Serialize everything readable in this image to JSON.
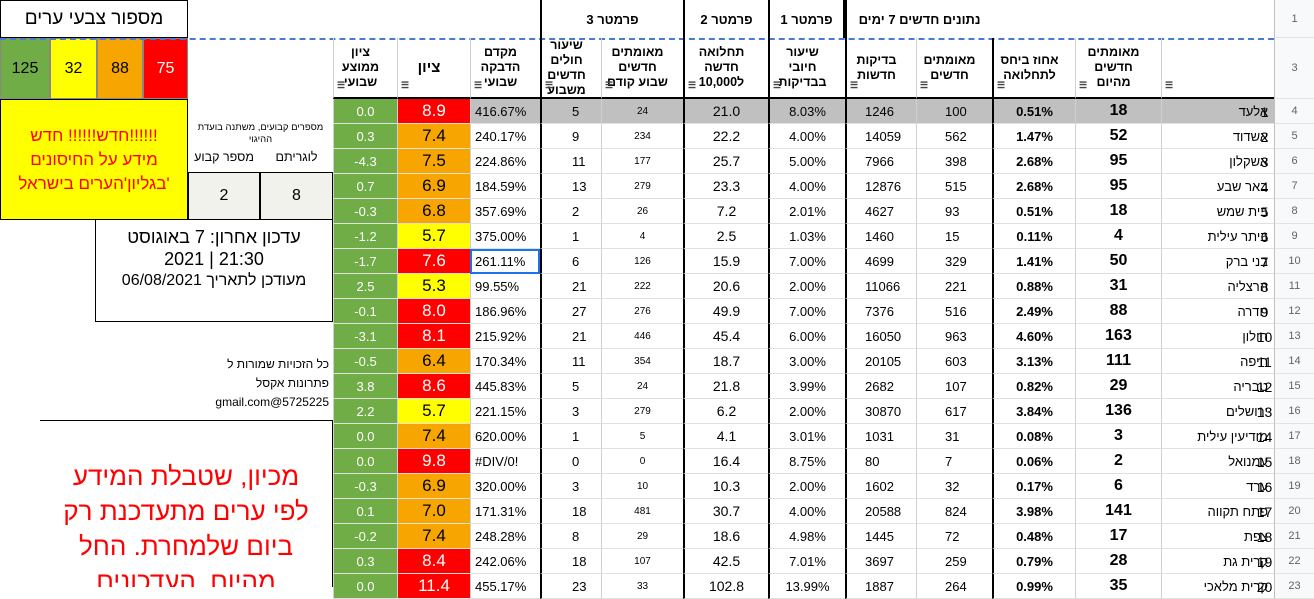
{
  "legend": {
    "title": "מספור צבעי ערים",
    "boxes": [
      {
        "value": "125",
        "color": "#70ad47"
      },
      {
        "value": "32",
        "color": "#ffff00"
      },
      {
        "value": "88",
        "color": "#f7a500"
      },
      {
        "value": "75",
        "color": "#ff0000"
      }
    ]
  },
  "notice": {
    "line1": "חדש!!!!!! חדש!!!!!!",
    "line2": "מידע על החיסונים",
    "line3": "בגליון'הערים בישראל'"
  },
  "constants": {
    "note": "מספרים קבועים, משתנה בועדת ההיגוי",
    "col1_label": "מספר קבוע",
    "col2_label": "לוגריתם",
    "col1_value": "2",
    "col2_value": "8"
  },
  "update": {
    "line1": "עדכון אחרון: 7 באוגוסט",
    "line2": "2021 | 21:30",
    "line3": "מעודכן לתאריך 06/08/2021"
  },
  "credit": {
    "line1": "כל הזכויות שמורות ל",
    "line2": "פתרונות אקסל",
    "line3": "gmail.com@5725225"
  },
  "red_note": {
    "line1": "מכיון, שטבלת המידע",
    "line2": "לפי ערים מתעדכנת רק",
    "line3": "ביום שלמחרת. החל",
    "line4": "מהיום, העדכונים"
  },
  "group_headers": {
    "g7days": "נתונים חדשים 7 ימים",
    "p1": "פרמטר 1",
    "p2": "פרמטר 2",
    "p3": "פרמטר 3"
  },
  "col_headers": {
    "city": "",
    "new_confirmed": "מאומתים חדשים מהיום",
    "pct_risk": "אחוז ביחס לתחלואה",
    "confirmed_new": "מאומתים חדשים",
    "tests": "בדיקות חדשות",
    "positive_rate": "שיעור חיובי בבדיקות",
    "morbidity": "תחלואה חדשה ל10,000",
    "prev_week": "מאומתים חדשים שבוע קודם",
    "recovery": "שיעור חולים חדשים משבוע",
    "infection": "מקדם הדבקה שבועי",
    "score": "ציון",
    "avg_score": "ציון ממוצע שבועי"
  },
  "row_numbers_top": [
    "1",
    "3"
  ],
  "rows": [
    {
      "n": "4",
      "city": "אלעד",
      "new": "18",
      "pct": "0.51%",
      "conf": "100",
      "tests": "1246",
      "pos": "8.03%",
      "morb": "21.0",
      "prev": "24",
      "rec": "5",
      "inf": "416.67%",
      "score": "8.9",
      "score_color": "#ff0000",
      "avg": "0.0"
    },
    {
      "n": "5",
      "city": "אשדוד",
      "new": "52",
      "pct": "1.47%",
      "conf": "562",
      "tests": "14059",
      "pos": "4.00%",
      "morb": "22.2",
      "prev": "234",
      "rec": "9",
      "inf": "240.17%",
      "score": "7.4",
      "score_color": "#f7a500",
      "avg": "0.3"
    },
    {
      "n": "6",
      "city": "אשקלון",
      "new": "95",
      "pct": "2.68%",
      "conf": "398",
      "tests": "7966",
      "pos": "5.00%",
      "morb": "25.7",
      "prev": "177",
      "rec": "11",
      "inf": "224.86%",
      "score": "7.5",
      "score_color": "#f7a500",
      "avg": "-4.3"
    },
    {
      "n": "7",
      "city": "באר שבע",
      "new": "95",
      "pct": "2.68%",
      "conf": "515",
      "tests": "12876",
      "pos": "4.00%",
      "morb": "23.3",
      "prev": "279",
      "rec": "13",
      "inf": "184.59%",
      "score": "6.9",
      "score_color": "#f7a500",
      "avg": "0.7"
    },
    {
      "n": "8",
      "city": "בית שמש",
      "new": "18",
      "pct": "0.51%",
      "conf": "93",
      "tests": "4627",
      "pos": "2.01%",
      "morb": "7.2",
      "prev": "26",
      "rec": "2",
      "inf": "357.69%",
      "score": "6.8",
      "score_color": "#f7a500",
      "avg": "-0.3"
    },
    {
      "n": "9",
      "city": "ביתר עילית",
      "new": "4",
      "pct": "0.11%",
      "conf": "15",
      "tests": "1460",
      "pos": "1.03%",
      "morb": "2.5",
      "prev": "4",
      "rec": "1",
      "inf": "375.00%",
      "score": "5.7",
      "score_color": "#ffff00",
      "avg": "-1.2"
    },
    {
      "n": "10",
      "city": "בני ברק",
      "new": "50",
      "pct": "1.41%",
      "conf": "329",
      "tests": "4699",
      "pos": "7.00%",
      "morb": "15.9",
      "prev": "126",
      "rec": "6",
      "inf": "261.11%",
      "score": "7.6",
      "score_color": "#ff0000",
      "avg": "-1.7"
    },
    {
      "n": "11",
      "city": "הרצליה",
      "new": "31",
      "pct": "0.88%",
      "conf": "221",
      "tests": "11066",
      "pos": "2.00%",
      "morb": "20.6",
      "prev": "222",
      "rec": "21",
      "inf": "99.55%",
      "score": "5.3",
      "score_color": "#ffff00",
      "avg": "2.5"
    },
    {
      "n": "12",
      "city": "חדרה",
      "new": "88",
      "pct": "2.49%",
      "conf": "516",
      "tests": "7376",
      "pos": "7.00%",
      "morb": "49.9",
      "prev": "276",
      "rec": "27",
      "inf": "186.96%",
      "score": "8.0",
      "score_color": "#ff0000",
      "avg": "-0.1"
    },
    {
      "n": "13",
      "city": "חולון",
      "new": "163",
      "pct": "4.60%",
      "conf": "963",
      "tests": "16050",
      "pos": "6.00%",
      "morb": "45.4",
      "prev": "446",
      "rec": "21",
      "inf": "215.92%",
      "score": "8.1",
      "score_color": "#ff0000",
      "avg": "-3.1"
    },
    {
      "n": "14",
      "city": "חיפה",
      "new": "111",
      "pct": "3.13%",
      "conf": "603",
      "tests": "20105",
      "pos": "3.00%",
      "morb": "18.7",
      "prev": "354",
      "rec": "11",
      "inf": "170.34%",
      "score": "6.4",
      "score_color": "#f7a500",
      "avg": "-0.5"
    },
    {
      "n": "15",
      "city": "טבריה",
      "new": "29",
      "pct": "0.82%",
      "conf": "107",
      "tests": "2682",
      "pos": "3.99%",
      "morb": "21.8",
      "prev": "24",
      "rec": "5",
      "inf": "445.83%",
      "score": "8.6",
      "score_color": "#ff0000",
      "avg": "3.8"
    },
    {
      "n": "16",
      "city": "ירושלים",
      "new": "136",
      "pct": "3.84%",
      "conf": "617",
      "tests": "30870",
      "pos": "2.00%",
      "morb": "6.2",
      "prev": "279",
      "rec": "3",
      "inf": "221.15%",
      "score": "5.7",
      "score_color": "#ffff00",
      "avg": "2.2"
    },
    {
      "n": "17",
      "city": "מודיעין עילית",
      "new": "3",
      "pct": "0.08%",
      "conf": "31",
      "tests": "1031",
      "pos": "3.01%",
      "morb": "4.1",
      "prev": "5",
      "rec": "1",
      "inf": "620.00%",
      "score": "7.4",
      "score_color": "#f7a500",
      "avg": "0.0"
    },
    {
      "n": "18",
      "city": "עמנואל",
      "new": "2",
      "pct": "0.06%",
      "conf": "7",
      "tests": "80",
      "pos": "8.75%",
      "morb": "16.4",
      "prev": "0",
      "rec": "0",
      "inf": "#DIV/0!",
      "score": "9.8",
      "score_color": "#ff0000",
      "avg": "0.0"
    },
    {
      "n": "19",
      "city": "ערד",
      "new": "6",
      "pct": "0.17%",
      "conf": "32",
      "tests": "1602",
      "pos": "2.00%",
      "morb": "10.3",
      "prev": "10",
      "rec": "3",
      "inf": "320.00%",
      "score": "6.9",
      "score_color": "#f7a500",
      "avg": "-0.3"
    },
    {
      "n": "20",
      "city": "פתח תקווה",
      "new": "141",
      "pct": "3.98%",
      "conf": "824",
      "tests": "20588",
      "pos": "4.00%",
      "morb": "30.7",
      "prev": "481",
      "rec": "18",
      "inf": "171.31%",
      "score": "7.0",
      "score_color": "#f7a500",
      "avg": "0.1"
    },
    {
      "n": "21",
      "city": "צפת",
      "new": "17",
      "pct": "0.48%",
      "conf": "72",
      "tests": "1445",
      "pos": "4.98%",
      "morb": "18.6",
      "prev": "29",
      "rec": "8",
      "inf": "248.28%",
      "score": "7.4",
      "score_color": "#f7a500",
      "avg": "-0.2"
    },
    {
      "n": "22",
      "city": "קרית גת",
      "new": "28",
      "pct": "0.79%",
      "conf": "259",
      "tests": "3697",
      "pos": "7.01%",
      "morb": "42.5",
      "prev": "107",
      "rec": "18",
      "inf": "242.06%",
      "score": "8.4",
      "score_color": "#ff0000",
      "avg": "0.3"
    },
    {
      "n": "23",
      "city": "קרית מלאכי",
      "new": "35",
      "pct": "0.99%",
      "conf": "264",
      "tests": "1887",
      "pos": "13.99%",
      "morb": "102.8",
      "prev": "33",
      "rec": "23",
      "inf": "455.17%",
      "score": "11.4",
      "score_color": "#ff0000",
      "avg": "0.0"
    }
  ],
  "colors": {
    "avg_green": "#70ad47",
    "header_bg": "#ffffff",
    "selected_row": "#c0c0c0"
  }
}
